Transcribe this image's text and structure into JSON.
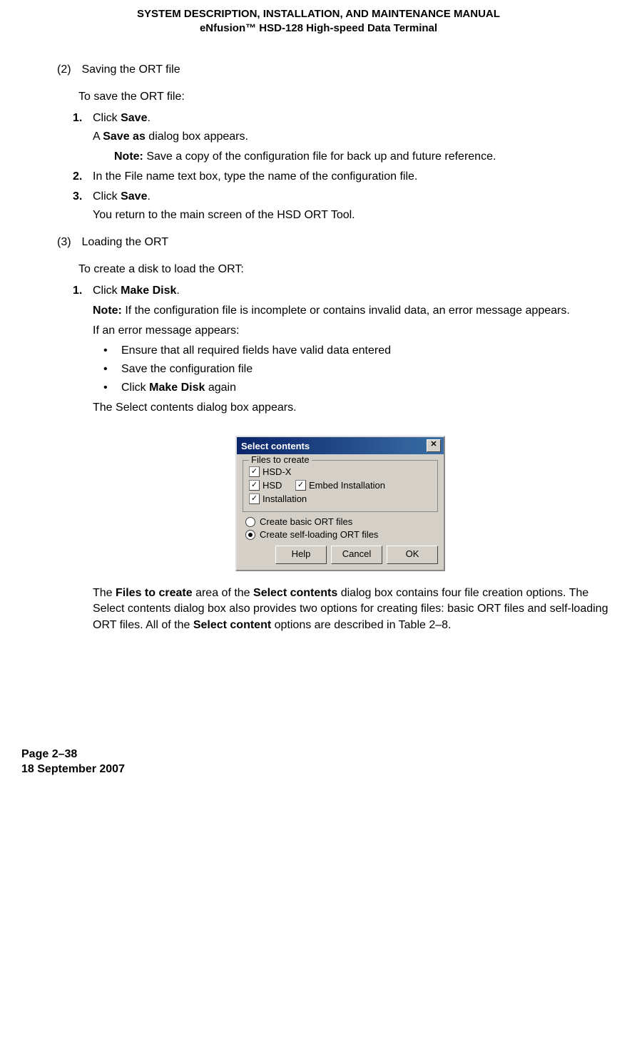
{
  "header": {
    "line1": "SYSTEM DESCRIPTION, INSTALLATION, AND MAINTENANCE MANUAL",
    "line2": "eNfusion™ HSD-128 High-speed Data Terminal"
  },
  "section2": {
    "num": "(2)",
    "title": "Saving the ORT file",
    "intro": "To save the ORT file:",
    "step1_num": "1.",
    "step1_a": "Click ",
    "step1_b": "Save",
    "step1_c": ".",
    "step1_body_a": "A ",
    "step1_body_b": "Save as",
    "step1_body_c": " dialog box appears.",
    "note_label": "Note: ",
    "note_text": "Save a copy of the configuration file for back up and future reference.",
    "step2_num": "2.",
    "step2_text": "In the File name text box, type the name of the configuration file.",
    "step3_num": "3.",
    "step3_a": "Click ",
    "step3_b": "Save",
    "step3_c": ".",
    "step3_body": "You return to the main screen of the HSD ORT Tool."
  },
  "section3": {
    "num": "(3)",
    "title": "Loading the ORT",
    "intro": "To create a disk to load the ORT:",
    "step1_num": "1.",
    "step1_a": "Click ",
    "step1_b": "Make Disk",
    "step1_c": ".",
    "note_label": "Note: ",
    "note_text": "If the configuration file is incomplete or contains invalid data, an error message appears.",
    "err_intro": "If an error message appears:",
    "bullet1": "Ensure that all required fields have valid data entered",
    "bullet2": "Save the configuration file",
    "bullet3_a": "Click ",
    "bullet3_b": "Make Disk",
    "bullet3_c": " again",
    "select_line": "The Select contents dialog box appears."
  },
  "dialog": {
    "title": "Select contents",
    "close": "✕",
    "group_label": "Files to create",
    "check_mark": "✓",
    "cb1": "HSD-X",
    "cb2": "HSD",
    "cb3": "Embed Installation",
    "cb4": "Installation",
    "radio1": "Create basic ORT files",
    "radio2": "Create self-loading ORT files",
    "btn_help": "Help",
    "btn_cancel": "Cancel",
    "btn_ok": "OK"
  },
  "after_para": {
    "t1": "The ",
    "t2": "Files to create",
    "t3": " area of the ",
    "t4": "Select contents",
    "t5": " dialog box contains four file creation options. The Select contents dialog box also provides two options for creating files: basic ORT files and self-loading ORT files. All of the ",
    "t6": "Select content",
    "t7": " options are described in Table 2–8."
  },
  "footer": {
    "page": "Page 2–38",
    "date": "18 September 2007"
  }
}
